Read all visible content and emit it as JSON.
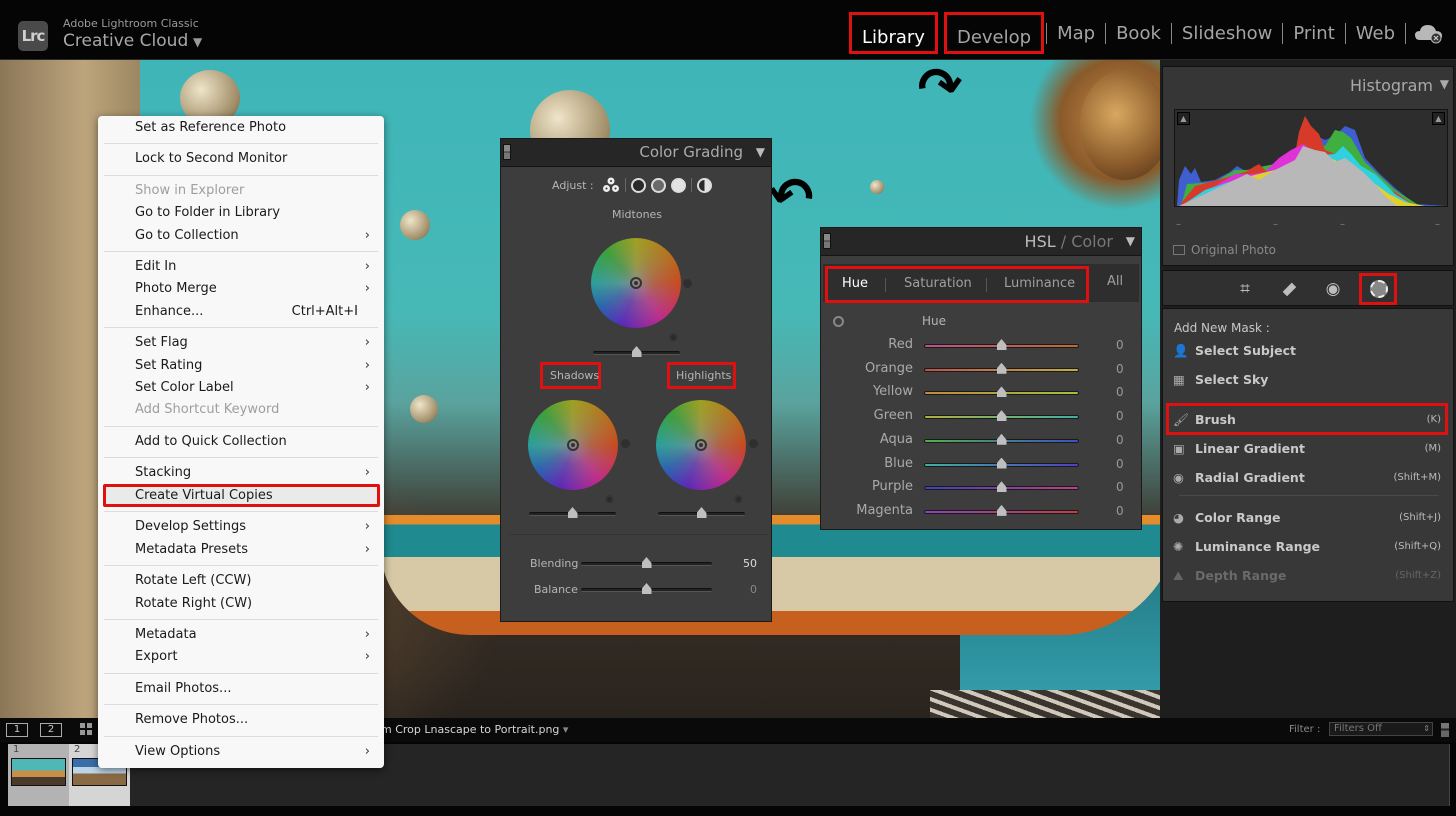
{
  "app": {
    "logo": "Lrc",
    "subtitle": "Adobe Lightroom Classic",
    "title": "Creative Cloud",
    "dropdown_icon": "triangle-down"
  },
  "modules": [
    {
      "label": "Library",
      "active": true,
      "highlighted": true
    },
    {
      "label": "Develop",
      "active": false,
      "highlighted": true
    },
    {
      "label": "Map",
      "active": false,
      "highlighted": false
    },
    {
      "label": "Book",
      "active": false,
      "highlighted": false
    },
    {
      "label": "Slideshow",
      "active": false,
      "highlighted": false
    },
    {
      "label": "Print",
      "active": false,
      "highlighted": false
    },
    {
      "label": "Web",
      "active": false,
      "highlighted": false
    }
  ],
  "cloud_icon": "cloud-sync-icon",
  "context_menu": {
    "groups": [
      [
        {
          "label": "Set as Reference Photo"
        }
      ],
      [
        {
          "label": "Lock to Second Monitor"
        }
      ],
      [
        {
          "label": "Show in Explorer",
          "disabled": true
        },
        {
          "label": "Go to Folder in Library"
        },
        {
          "label": "Go to Collection",
          "submenu": true
        }
      ],
      [
        {
          "label": "Edit In",
          "submenu": true
        },
        {
          "label": "Photo Merge",
          "submenu": true
        },
        {
          "label": "Enhance...",
          "shortcut": "Ctrl+Alt+I"
        }
      ],
      [
        {
          "label": "Set Flag",
          "submenu": true
        },
        {
          "label": "Set Rating",
          "submenu": true
        },
        {
          "label": "Set Color Label",
          "submenu": true
        },
        {
          "label": "Add Shortcut Keyword",
          "disabled": true
        }
      ],
      [
        {
          "label": "Add to Quick Collection"
        }
      ],
      [
        {
          "label": "Stacking",
          "submenu": true
        },
        {
          "label": "Create Virtual Copies",
          "highlighted": true
        }
      ],
      [
        {
          "label": "Develop Settings",
          "submenu": true
        },
        {
          "label": "Metadata Presets",
          "submenu": true
        }
      ],
      [
        {
          "label": "Rotate Left (CCW)"
        },
        {
          "label": "Rotate Right (CW)"
        }
      ],
      [
        {
          "label": "Metadata",
          "submenu": true
        },
        {
          "label": "Export",
          "submenu": true
        }
      ],
      [
        {
          "label": "Email Photos..."
        }
      ],
      [
        {
          "label": "Remove Photos..."
        }
      ],
      [
        {
          "label": "View Options",
          "submenu": true
        }
      ]
    ]
  },
  "color_grading": {
    "title": "Color Grading",
    "adjust_label": "Adjust :",
    "midtones_label": "Midtones",
    "shadows_label": "Shadows",
    "highlights_label": "Highlights",
    "midtones_luminance": 0.5,
    "shadows_luminance": 0.5,
    "highlights_luminance": 0.5,
    "blending_label": "Blending",
    "blending_value": "50",
    "balance_label": "Balance",
    "balance_value": "0"
  },
  "hsl": {
    "title_main": "HSL",
    "title_sep": " / ",
    "title_alt": "Color",
    "tabs": [
      "Hue",
      "Saturation",
      "Luminance",
      "All"
    ],
    "active_tab": "Hue",
    "section_label": "Hue",
    "rows": [
      {
        "label": "Red",
        "value": "0",
        "from": "#c0508a",
        "to": "#c06a30"
      },
      {
        "label": "Orange",
        "value": "0",
        "from": "#c05050",
        "to": "#c0b040"
      },
      {
        "label": "Yellow",
        "value": "0",
        "from": "#c08a40",
        "to": "#a0c040"
      },
      {
        "label": "Green",
        "value": "0",
        "from": "#b0b040",
        "to": "#40b0a0"
      },
      {
        "label": "Aqua",
        "value": "0",
        "from": "#50b050",
        "to": "#4050c0"
      },
      {
        "label": "Blue",
        "value": "0",
        "from": "#40b0a0",
        "to": "#5040c0"
      },
      {
        "label": "Purple",
        "value": "0",
        "from": "#4040c0",
        "to": "#c04080"
      },
      {
        "label": "Magenta",
        "value": "0",
        "from": "#9040c0",
        "to": "#c04040"
      }
    ]
  },
  "histogram": {
    "title": "Histogram",
    "original_photo_label": "Original Photo"
  },
  "tools": [
    "crop-icon",
    "healing-icon",
    "redeye-icon",
    "masking-icon"
  ],
  "masks": {
    "heading": "Add New Mask :",
    "items": [
      {
        "label": "Select Subject",
        "icon": "person-icon",
        "shortcut": ""
      },
      {
        "label": "Select Sky",
        "icon": "sky-icon",
        "shortcut": ""
      },
      {
        "label": "Brush",
        "icon": "brush-icon",
        "shortcut": "(K)",
        "highlighted": true
      },
      {
        "label": "Linear Gradient",
        "icon": "linear-gradient-icon",
        "shortcut": "(M)"
      },
      {
        "label": "Radial Gradient",
        "icon": "radial-gradient-icon",
        "shortcut": "(Shift+M)"
      },
      {
        "label": "Color Range",
        "icon": "color-range-icon",
        "shortcut": "(Shift+J)"
      },
      {
        "label": "Luminance Range",
        "icon": "luminance-range-icon",
        "shortcut": "(Shift+Q)"
      },
      {
        "label": "Depth Range",
        "icon": "depth-range-icon",
        "shortcut": "(Shift+Z)",
        "disabled": true
      }
    ]
  },
  "filmstrip": {
    "view1": "1",
    "view2": "2",
    "filename": "m Crop Lnascape to Portrait.png",
    "filename_dropdown": "▾",
    "filter_label": "Filter :",
    "filter_value": "Filters Off",
    "thumbnails": [
      {
        "index": "1"
      },
      {
        "index": "2"
      }
    ]
  }
}
